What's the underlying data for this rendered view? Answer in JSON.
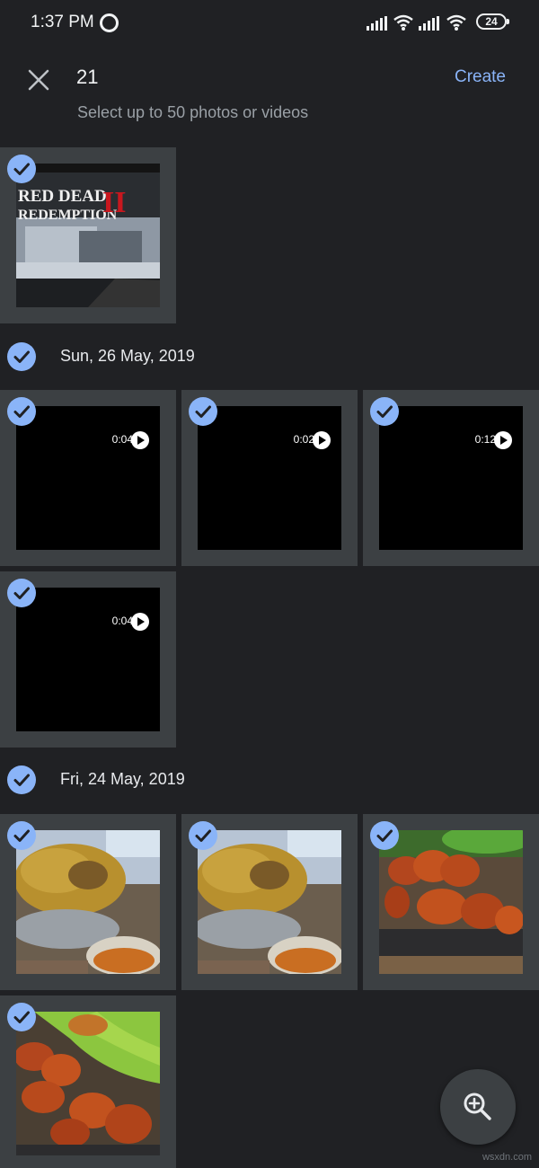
{
  "status_bar": {
    "time": "1:37 PM",
    "battery": "24"
  },
  "header": {
    "selected_count": "21",
    "create_label": "Create",
    "subtitle": "Select up to 50 photos or videos"
  },
  "groups": [
    {
      "date": ""
    },
    {
      "date": "Sun, 26 May, 2019"
    },
    {
      "date": "Fri, 24 May, 2019"
    }
  ],
  "items": [
    {
      "type": "photo",
      "subject": "red-dead-redemption-2-screen",
      "duration": ""
    },
    {
      "type": "video",
      "duration": "0:04"
    },
    {
      "type": "video",
      "duration": "0:02"
    },
    {
      "type": "video",
      "duration": "0:12"
    },
    {
      "type": "video",
      "duration": "0:04"
    },
    {
      "type": "photo",
      "subject": "biryani"
    },
    {
      "type": "photo",
      "subject": "biryani"
    },
    {
      "type": "photo",
      "subject": "fried-chicken"
    },
    {
      "type": "photo",
      "subject": "fried-chicken-on-leaf"
    }
  ],
  "photo_text": {
    "rdr_line1": "RED DEAD",
    "rdr_line2": "REDEMPTION",
    "rdr_numeral": "II"
  },
  "fab": {
    "icon": "zoom-in-icon"
  },
  "watermark": "wsxdn.com",
  "colors": {
    "accent": "#8ab4f8",
    "background": "#202124",
    "tile": "#3c4043"
  }
}
